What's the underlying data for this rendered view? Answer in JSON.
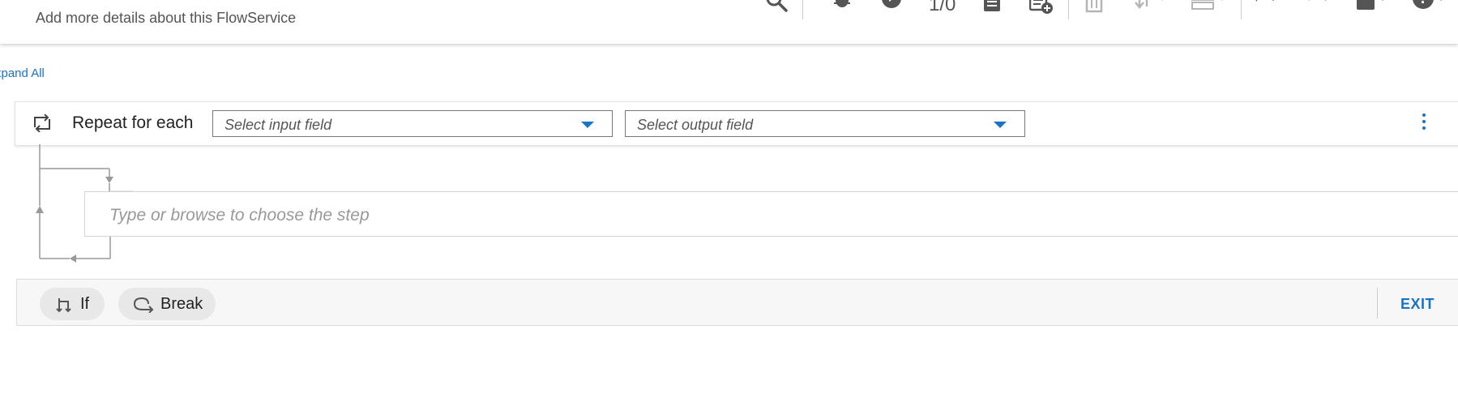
{
  "header": {
    "subtitle": "Add more details about this FlowService",
    "counter": "1/0",
    "icons": [
      "search-icon",
      "debug-icon",
      "run-icon",
      "document-icon",
      "document-add-icon",
      "delete-icon",
      "move-icon",
      "layout-icon",
      "undo-icon",
      "redo-icon",
      "save-icon",
      "help-icon"
    ]
  },
  "expand_all": "xpand All",
  "repeat": {
    "label": "Repeat for each",
    "input_placeholder": "Select input field",
    "output_placeholder": "Select output field"
  },
  "step": {
    "placeholder": "Type or browse to choose the step"
  },
  "bottom": {
    "if_label": "If",
    "break_label": "Break",
    "exit_label": "EXIT"
  },
  "colors": {
    "accent": "#1a73c6",
    "icon_gray": "#555555",
    "disabled_gray": "#b5b5b5"
  }
}
